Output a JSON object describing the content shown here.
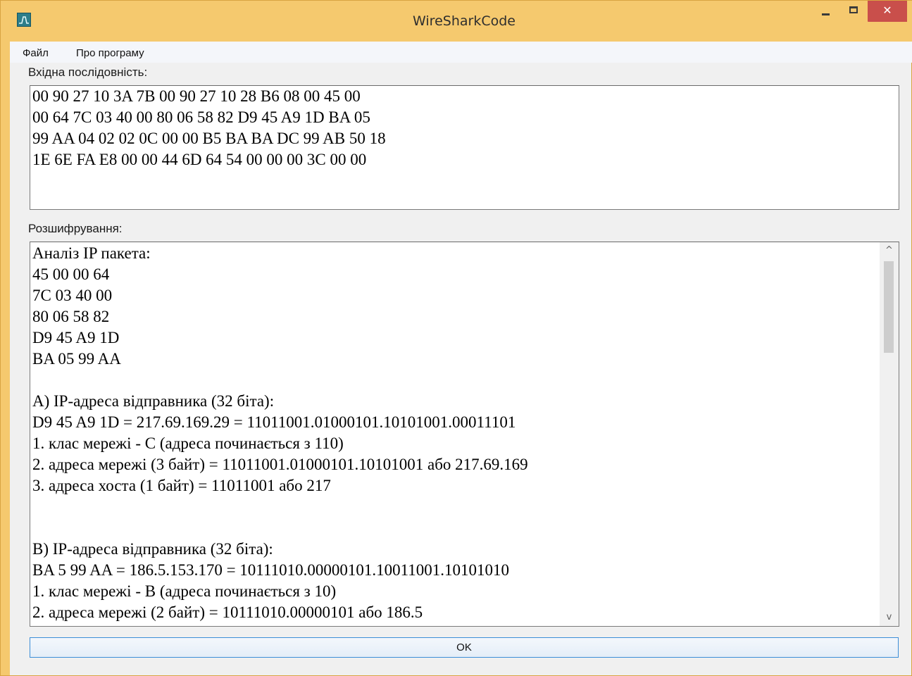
{
  "window": {
    "title": "WireSharkCode",
    "minimize_glyph": "–",
    "maximize_glyph": "□",
    "close_glyph": "✕",
    "icon": "app-waveform-icon",
    "accent_color": "#f5c96e",
    "close_color": "#c94f4b"
  },
  "menu": {
    "items": [
      {
        "label": "Файл"
      },
      {
        "label": "Про програму"
      }
    ]
  },
  "input": {
    "label": "Вхідна послідовність:",
    "lines": [
      "00 90 27 10 3A 7B 00 90 27 10 28 B6 08 00 45 00",
      "00 64 7C 03 40 00 80 06 58 82 D9 45 A9 1D BA 05",
      "99 AA 04 02 02 0C 00 00 B5 BA BA DC 99 AB 50 18",
      "1E 6E FA E8 00 00 44 6D 64 54 00 00 00 3C 00 00"
    ]
  },
  "output": {
    "label": "Розшифрування:",
    "lines": [
      "Аналіз IP пакета:",
      "45 00 00 64",
      "7C 03 40 00",
      "80 06 58 82",
      "D9 45 A9 1D",
      "BA 05 99 AA",
      "",
      "A) IP-адреса відправника (32 біта):",
      "D9 45 A9 1D = 217.69.169.29 = 11011001.01000101.10101001.00011101",
      "1. клас мережі - C (адреса починається з 110)",
      "2. адреса мережі (3 байт) = 11011001.01000101.10101001 або 217.69.169",
      "3. адреса хоста (1 байт) = 11011001 або 217",
      "",
      "",
      "B) IP-адреса відправника (32 біта):",
      "BA 5 99 AA = 186.5.153.170 = 10111010.00000101.10011001.10101010",
      "1. клас мережі - B (адреса починається з 10)",
      "2. адреса мережі (2 байт) = 10111010.00000101 або 186.5"
    ],
    "scroll_up_glyph": "^",
    "scroll_down_glyph": "v"
  },
  "ok_button": {
    "label": "OK"
  }
}
